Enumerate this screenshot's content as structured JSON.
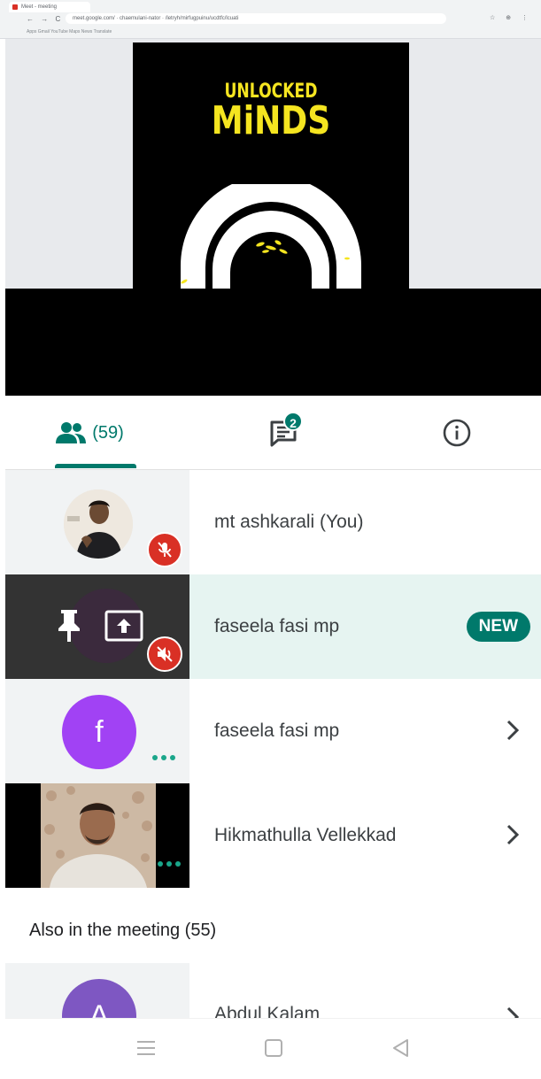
{
  "browser": {
    "tab_title": "Meet - meeting",
    "nav_glyphs": "← → C",
    "url": "meet.google.com/ · chaemulani-nator · /letryh/mirfugpuinu/ucdtfc/lcuati",
    "bookmarks": "Apps   Gmail   YouTube   Maps   News   Translate",
    "extension_glyphs": "☆ ⊕ ⋮"
  },
  "slide": {
    "logo_line1": "UNLOCKED",
    "logo_line2": "MiNDS"
  },
  "tabs": {
    "people_count": "(59)",
    "chat_badge": "2"
  },
  "participants": [
    {
      "name": "mt ashkarali (You)",
      "muted": true
    },
    {
      "name": "faseela fasi mp",
      "badge": "NEW",
      "presenting": true,
      "muted": true
    },
    {
      "name": "faseela fasi mp",
      "avatar_letter": "f"
    },
    {
      "name": "Hikmathulla Vellekkad"
    }
  ],
  "also_in_meeting": {
    "label": "Also in the meeting (55)",
    "first": {
      "name": "Abdul Kalam",
      "avatar_letter": "A"
    }
  },
  "colors": {
    "accent": "#00796b",
    "mute_red": "#d93025",
    "avatar_purple": "#a142f4",
    "logo_yellow": "#f5e520",
    "highlight_row": "#e6f4f1"
  },
  "icons": {
    "people_tab": "people-icon",
    "chat_tab": "chat-icon",
    "info_tab": "info-icon",
    "muted": "mic-off-icon",
    "presenting": "present-screen-icon",
    "pin": "pin-icon",
    "more": "more-dots-icon",
    "chevron": "chevron-right-icon"
  }
}
